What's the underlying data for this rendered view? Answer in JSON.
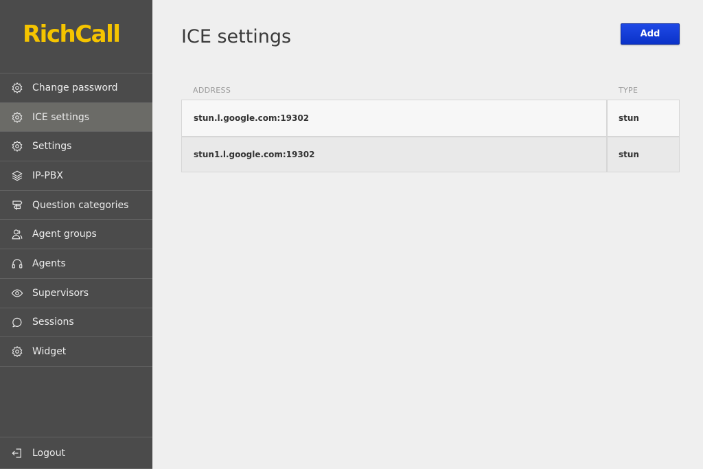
{
  "brand": {
    "name": "RichCall",
    "color": "#f5c400"
  },
  "sidebar": {
    "items": [
      {
        "label": "Change password",
        "icon": "gear-icon",
        "active": false
      },
      {
        "label": "ICE settings",
        "icon": "gear-icon",
        "active": true
      },
      {
        "label": "Settings",
        "icon": "gear-icon",
        "active": false
      },
      {
        "label": "IP-PBX",
        "icon": "layers-icon",
        "active": false
      },
      {
        "label": "Question categories",
        "icon": "signpost-icon",
        "active": false
      },
      {
        "label": "Agent groups",
        "icon": "user-group-icon",
        "active": false
      },
      {
        "label": "Agents",
        "icon": "headset-icon",
        "active": false
      },
      {
        "label": "Supervisors",
        "icon": "eye-icon",
        "active": false
      },
      {
        "label": "Sessions",
        "icon": "speech-bubble-icon",
        "active": false
      },
      {
        "label": "Widget",
        "icon": "gear-icon",
        "active": false
      }
    ],
    "logout": {
      "label": "Logout",
      "icon": "logout-icon"
    }
  },
  "main": {
    "title": "ICE settings",
    "add_label": "Add",
    "accent": "#1e49e6",
    "table": {
      "columns": [
        "ADDRESS",
        "TYPE"
      ],
      "rows": [
        {
          "address": "stun.l.google.com:19302",
          "type": "stun"
        },
        {
          "address": "stun1.l.google.com:19302",
          "type": "stun"
        }
      ]
    }
  }
}
